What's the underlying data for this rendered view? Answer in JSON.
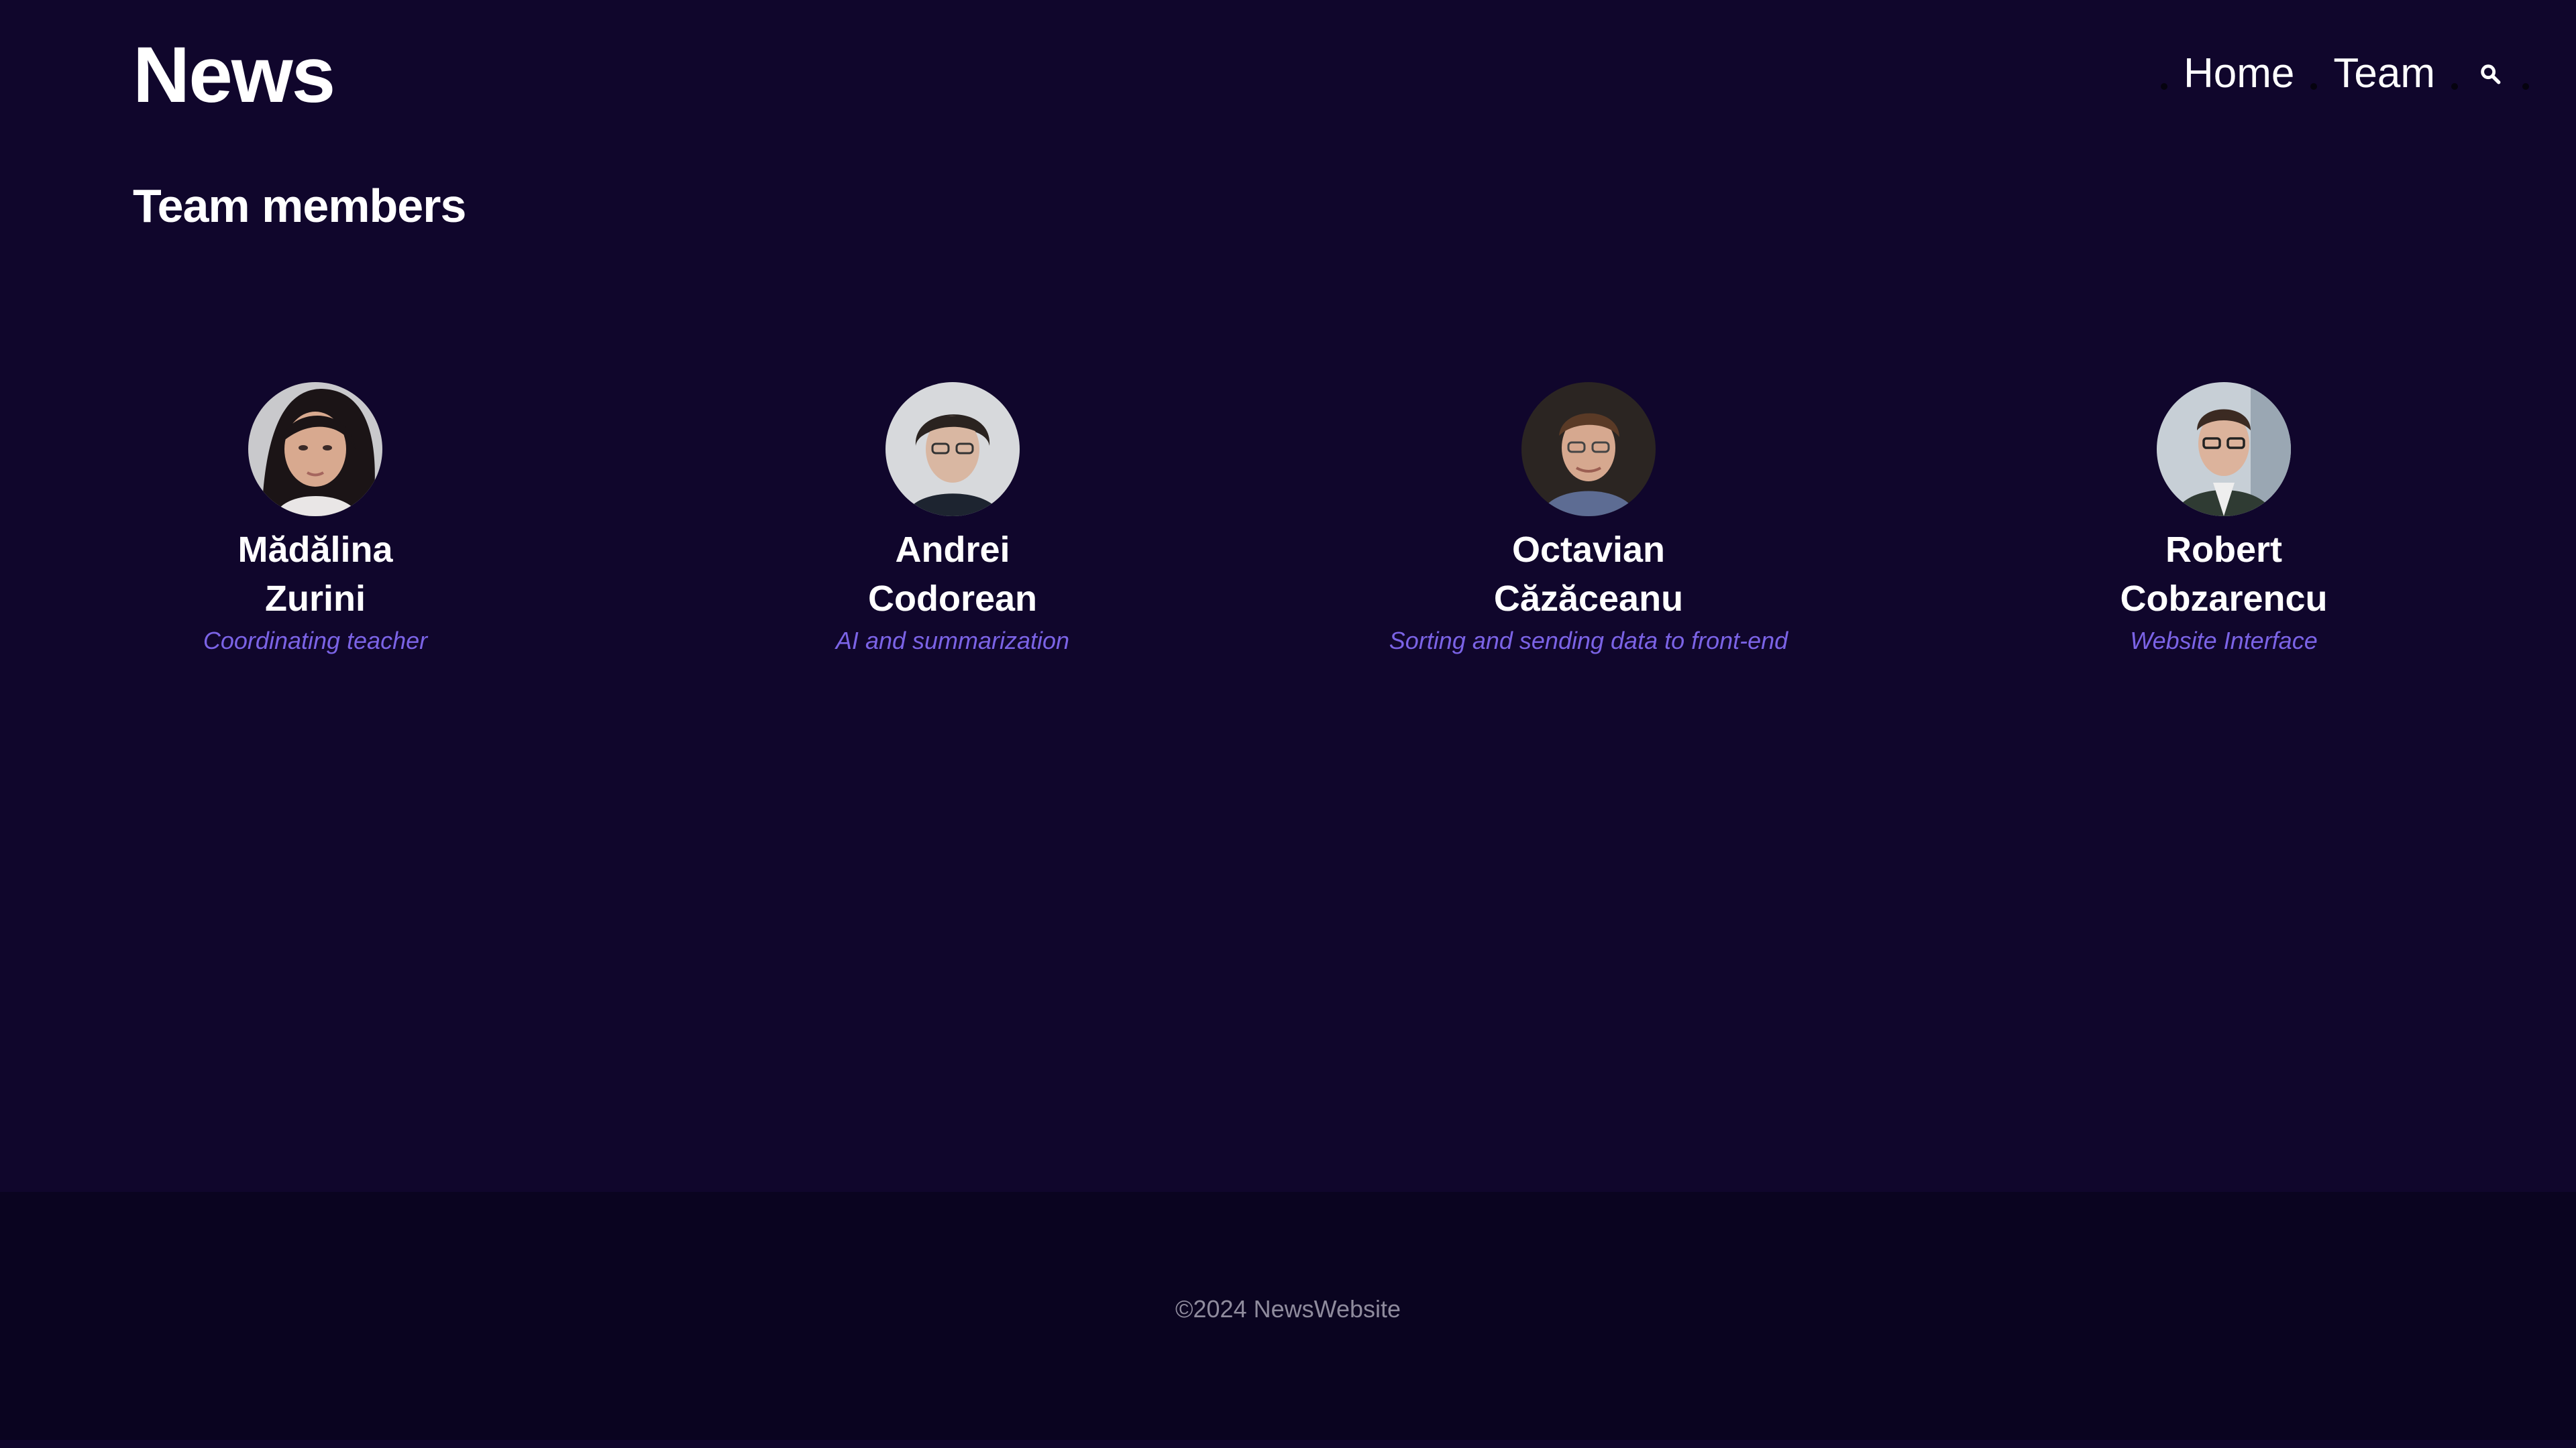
{
  "brand": {
    "title": "News"
  },
  "nav": {
    "items": [
      {
        "label": "Home"
      },
      {
        "label": "Team"
      }
    ],
    "search_icon": "search-icon"
  },
  "page": {
    "heading": "Team members"
  },
  "team": {
    "members": [
      {
        "first_name": "Mădălina",
        "last_name": "Zurini",
        "role": "Coordinating teacher",
        "avatar": "portrait-photo"
      },
      {
        "first_name": "Andrei",
        "last_name": "Codorean",
        "role": "AI and summarization",
        "avatar": "portrait-photo"
      },
      {
        "first_name": "Octavian",
        "last_name": "Căzăceanu",
        "role": "Sorting and sending data to front-end",
        "avatar": "portrait-photo"
      },
      {
        "first_name": "Robert",
        "last_name": "Cobzarencu",
        "role": "Website Interface",
        "avatar": "portrait-photo"
      }
    ]
  },
  "footer": {
    "copyright": "©2024 NewsWebsite"
  },
  "colors": {
    "background": "#10062c",
    "footer_background": "#0a0420",
    "accent": "#7b63e6",
    "text": "#ffffff",
    "muted_text": "#8f8b9d"
  }
}
